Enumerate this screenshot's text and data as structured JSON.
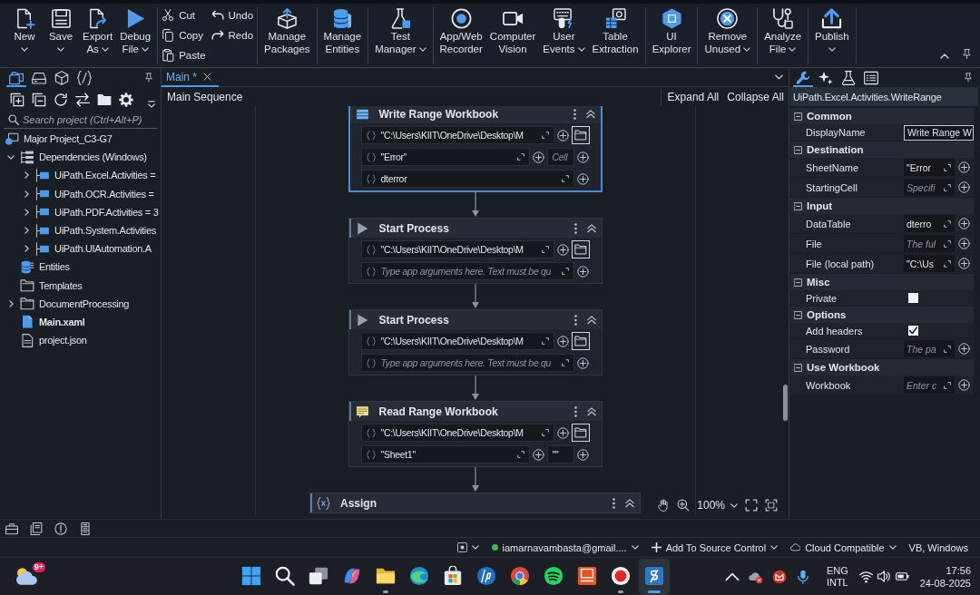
{
  "ribbon": {
    "groups": [
      {
        "kind": "large",
        "buttons": [
          {
            "kind": "new",
            "lines": [
              "New"
            ],
            "dropdown": true
          },
          {
            "kind": "save",
            "lines": [
              "Save"
            ],
            "dropdown": true
          },
          {
            "kind": "export",
            "lines": [
              "Export",
              "As"
            ],
            "dropdown": true
          },
          {
            "kind": "debug",
            "lines": [
              "Debug",
              "File"
            ],
            "dropdown": true
          }
        ]
      },
      {
        "kind": "small",
        "columns": [
          [
            {
              "kind": "cut",
              "label": "Cut"
            },
            {
              "kind": "copy",
              "label": "Copy"
            },
            {
              "kind": "paste",
              "label": "Paste"
            }
          ],
          [
            {
              "kind": "undo",
              "label": "Undo"
            },
            {
              "kind": "redo",
              "label": "Redo"
            }
          ]
        ]
      },
      {
        "kind": "large",
        "buttons": [
          {
            "kind": "manage-packages",
            "lines": [
              "Manage",
              "Packages"
            ],
            "dropdown": false
          }
        ]
      },
      {
        "kind": "large",
        "buttons": [
          {
            "kind": "manage-entities",
            "lines": [
              "Manage",
              "Entities"
            ],
            "dropdown": false
          }
        ]
      },
      {
        "kind": "large",
        "buttons": [
          {
            "kind": "test-manager",
            "lines": [
              "Test",
              "Manager"
            ],
            "dropdown": true
          }
        ]
      },
      {
        "kind": "large",
        "buttons": [
          {
            "kind": "recorder",
            "lines": [
              "App/Web",
              "Recorder"
            ],
            "dropdown": false
          },
          {
            "kind": "computer-vision",
            "lines": [
              "Computer",
              "Vision"
            ],
            "dropdown": false
          },
          {
            "kind": "user-events",
            "lines": [
              "User",
              "Events"
            ],
            "dropdown": true
          },
          {
            "kind": "table-extraction",
            "lines": [
              "Table",
              "Extraction"
            ],
            "dropdown": false
          }
        ]
      },
      {
        "kind": "large",
        "buttons": [
          {
            "kind": "ui-explorer",
            "lines": [
              "UI",
              "Explorer"
            ],
            "dropdown": false
          }
        ]
      },
      {
        "kind": "large",
        "buttons": [
          {
            "kind": "remove-unused",
            "lines": [
              "Remove",
              "Unused"
            ],
            "dropdown": true
          }
        ]
      },
      {
        "kind": "large",
        "buttons": [
          {
            "kind": "analyze",
            "lines": [
              "Analyze",
              "File"
            ],
            "dropdown": true
          }
        ]
      },
      {
        "kind": "large",
        "buttons": [
          {
            "kind": "publish",
            "lines": [
              "Publish"
            ],
            "dropdown": true
          }
        ]
      }
    ]
  },
  "explorer": {
    "tabs": [
      {
        "kind": "files",
        "selected": true
      },
      {
        "kind": "drive",
        "selected": false
      },
      {
        "kind": "cube",
        "selected": false
      },
      {
        "kind": "snippets",
        "selected": false
      }
    ],
    "search": {
      "placeholder": "Search project (Ctrl+Alt+P)"
    },
    "tree": [
      {
        "kind": "project",
        "label": "Major Project_C3-G7",
        "children": [
          {
            "kind": "dependencies",
            "label": "Dependencies (Windows)",
            "expanded": true,
            "main": false,
            "children": [
              {
                "kind": "package",
                "label": "UiPath.Excel.Activities =",
                "expanded": false
              },
              {
                "kind": "package",
                "label": "UiPath.OCR.Activities =",
                "expanded": false
              },
              {
                "kind": "package",
                "label": "UiPath.PDF.Activities = 3",
                "expanded": false
              },
              {
                "kind": "package",
                "label": "UiPath.System.Activities",
                "expanded": false
              },
              {
                "kind": "package",
                "label": "UiPath.UIAutomation.A",
                "expanded": false
              }
            ]
          },
          {
            "kind": "entities",
            "label": "Entities",
            "main": false
          },
          {
            "kind": "templates",
            "label": "Templates",
            "main": false
          },
          {
            "kind": "folder",
            "label": "DocumentProcessing",
            "expanded": false,
            "main": false
          },
          {
            "kind": "workflow",
            "label": "Main.xaml",
            "main": true
          },
          {
            "kind": "json",
            "label": "project.json",
            "main": false
          }
        ]
      }
    ]
  },
  "document_tabs": [
    {
      "label": "Main *",
      "selected": true
    }
  ],
  "designer": {
    "title": "Main Sequence",
    "actions": [
      "Expand All",
      "Collapse All"
    ],
    "activities": [
      {
        "kind": "write_range",
        "title": "Write Range Workbook",
        "selected": true,
        "rows": [
          {
            "fields": [
              {
                "kind": "expression",
                "value": "\"C:\\Users\\KIIT\\OneDrive\\Desktop\\M"
              }
            ],
            "browse": true
          },
          {
            "fields": [
              {
                "kind": "expression",
                "value": "\"Error\""
              },
              {
                "kind": "short",
                "placeholder": "Cell"
              }
            ],
            "browse": false
          },
          {
            "fields": [
              {
                "kind": "expression",
                "value": "dterror"
              }
            ],
            "browse": false
          }
        ]
      },
      {
        "kind": "start_process",
        "title": "Start Process",
        "selected": false,
        "rows": [
          {
            "fields": [
              {
                "kind": "expression",
                "value": "\"C:\\Users\\KIIT\\OneDrive\\Desktop\\M"
              }
            ],
            "browse": true
          },
          {
            "fields": [
              {
                "kind": "expression",
                "placeholder": "Type app arguments here. Text must be qu"
              }
            ],
            "browse": false
          }
        ]
      },
      {
        "kind": "start_process",
        "title": "Start Process",
        "selected": false,
        "rows": [
          {
            "fields": [
              {
                "kind": "expression",
                "value": "\"C:\\Users\\KIIT\\OneDrive\\Desktop\\M"
              }
            ],
            "browse": true
          },
          {
            "fields": [
              {
                "kind": "expression",
                "placeholder": "Type app arguments here. Text must be qu"
              }
            ],
            "browse": false
          }
        ]
      },
      {
        "kind": "read_range",
        "title": "Read Range Workbook",
        "selected": false,
        "rows": [
          {
            "fields": [
              {
                "kind": "expression",
                "value": "\"C:\\Users\\KIIT\\OneDrive\\Desktop\\M"
              }
            ],
            "browse": true
          },
          {
            "fields": [
              {
                "kind": "expression",
                "value": "\"Sheet1\""
              },
              {
                "kind": "short",
                "value": "\"\""
              }
            ],
            "browse": false
          }
        ]
      },
      {
        "kind": "assign",
        "title": "Assign",
        "selected": false
      }
    ],
    "zoom": "100%"
  },
  "properties": {
    "tabs": [
      {
        "kind": "properties",
        "selected": true
      },
      {
        "kind": "assistant",
        "selected": false
      },
      {
        "kind": "test",
        "selected": false
      },
      {
        "kind": "outline",
        "selected": false
      }
    ],
    "title": "UiPath.Excel.Activities.WriteRange",
    "categories": [
      {
        "name": "Common",
        "expanded": true,
        "items": [
          {
            "name": "DisplayName",
            "kind": "text",
            "value": "Write Range W"
          }
        ]
      },
      {
        "name": "Destination",
        "expanded": true,
        "items": [
          {
            "name": "SheetName",
            "kind": "expression",
            "value": "\"Error"
          },
          {
            "name": "StartingCell",
            "kind": "expression",
            "placeholder": "Specifi"
          }
        ]
      },
      {
        "name": "Input",
        "expanded": true,
        "items": [
          {
            "name": "DataTable",
            "kind": "expression",
            "value": "dterro"
          },
          {
            "name": "File",
            "kind": "expression",
            "placeholder": "The ful"
          },
          {
            "name": "File (local path)",
            "kind": "expression",
            "value": "\"C:\\Us"
          }
        ]
      },
      {
        "name": "Misc",
        "expanded": true,
        "items": [
          {
            "name": "Private",
            "kind": "checkbox",
            "checked": false
          }
        ]
      },
      {
        "name": "Options",
        "expanded": true,
        "items": [
          {
            "name": "Add headers",
            "kind": "checkbox",
            "checked": true
          },
          {
            "name": "Password",
            "kind": "expression",
            "placeholder": "The pa"
          }
        ]
      },
      {
        "name": "Use Workbook",
        "expanded": true,
        "items": [
          {
            "name": "Workbook",
            "kind": "expression",
            "placeholder": "Enter c"
          }
        ]
      }
    ]
  },
  "status_bar": {
    "items": [
      {
        "kind": "panel",
        "dropdown": true
      },
      {
        "kind": "account",
        "label": "iamarnavambasta@gmail....",
        "dropdown": true
      },
      {
        "kind": "source_control",
        "label": "Add To Source Control",
        "dropdown": true
      },
      {
        "kind": "cloud",
        "label": "Cloud Compatible",
        "dropdown": true
      },
      {
        "kind": "text",
        "label": "VB, Windows",
        "dropdown": false
      }
    ]
  },
  "taskbar": {
    "weather": {
      "badge": "9+"
    },
    "apps": [
      {
        "kind": "start",
        "running": false,
        "selected": false
      },
      {
        "kind": "search",
        "running": false,
        "selected": false
      },
      {
        "kind": "task_view",
        "running": false,
        "selected": false
      },
      {
        "kind": "copilot",
        "running": false,
        "selected": false
      },
      {
        "kind": "files",
        "running": true,
        "selected": false
      },
      {
        "kind": "edge",
        "running": false,
        "selected": false
      },
      {
        "kind": "store",
        "running": false,
        "selected": false
      },
      {
        "kind": "hp",
        "running": false,
        "selected": false
      },
      {
        "kind": "chrome",
        "running": false,
        "selected": false
      },
      {
        "kind": "spotify",
        "running": false,
        "selected": false
      },
      {
        "kind": "orange",
        "running": false,
        "selected": false
      },
      {
        "kind": "recorder",
        "running": true,
        "selected": false
      },
      {
        "kind": "studio",
        "running": true,
        "selected": true
      }
    ],
    "language": [
      "ENG",
      "INTL"
    ],
    "clock": {
      "time": "17:56",
      "date": "24-08-2025"
    }
  }
}
